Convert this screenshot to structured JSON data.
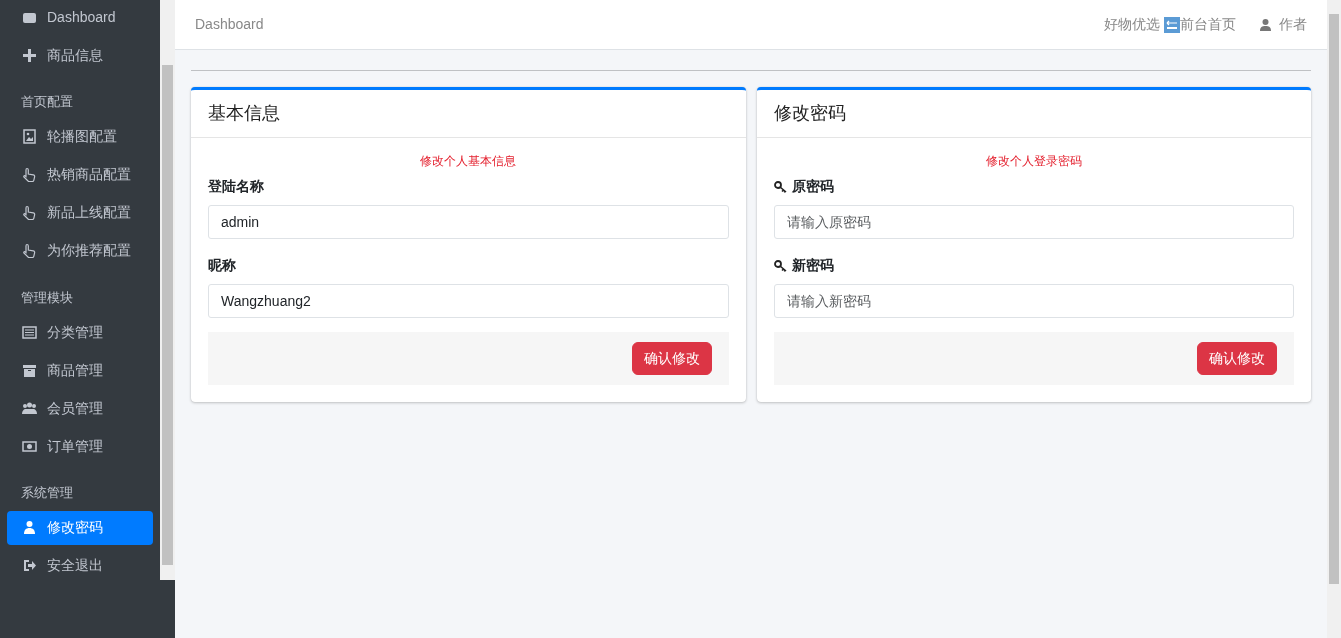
{
  "sidebar": {
    "groups": [
      {
        "items": [
          {
            "label": "Dashboard",
            "selected": false
          },
          {
            "label": "商品信息",
            "selected": false
          }
        ]
      },
      {
        "header": "首页配置",
        "items": [
          {
            "label": "轮播图配置",
            "selected": false
          },
          {
            "label": "热销商品配置",
            "selected": false
          },
          {
            "label": "新品上线配置",
            "selected": false
          },
          {
            "label": "为你推荐配置",
            "selected": false
          }
        ]
      },
      {
        "header": "管理模块",
        "items": [
          {
            "label": "分类管理",
            "selected": false
          },
          {
            "label": "商品管理",
            "selected": false
          },
          {
            "label": "会员管理",
            "selected": false
          },
          {
            "label": "订单管理",
            "selected": false
          }
        ]
      },
      {
        "header": "系统管理",
        "items": [
          {
            "label": "修改密码",
            "selected": true
          },
          {
            "label": "安全退出",
            "selected": false
          }
        ]
      }
    ]
  },
  "navbar": {
    "title": "Dashboard",
    "brand": "好物优选",
    "home_link": "前台首页",
    "user": "作者"
  },
  "cards": [
    {
      "title": "基本信息",
      "hint": "修改个人基本信息",
      "fields": [
        {
          "kind": "text",
          "label": "登陆名称",
          "value": "admin"
        },
        {
          "kind": "text",
          "label": "昵称",
          "value": "Wangzhuang2"
        }
      ],
      "button": "确认修改"
    },
    {
      "title": "修改密码",
      "hint": "修改个人登录密码",
      "fields": [
        {
          "kind": "password",
          "label": "原密码",
          "placeholder": "请输入原密码"
        },
        {
          "kind": "password",
          "label": "新密码",
          "placeholder": "请输入新密码"
        }
      ],
      "button": "确认修改"
    }
  ]
}
